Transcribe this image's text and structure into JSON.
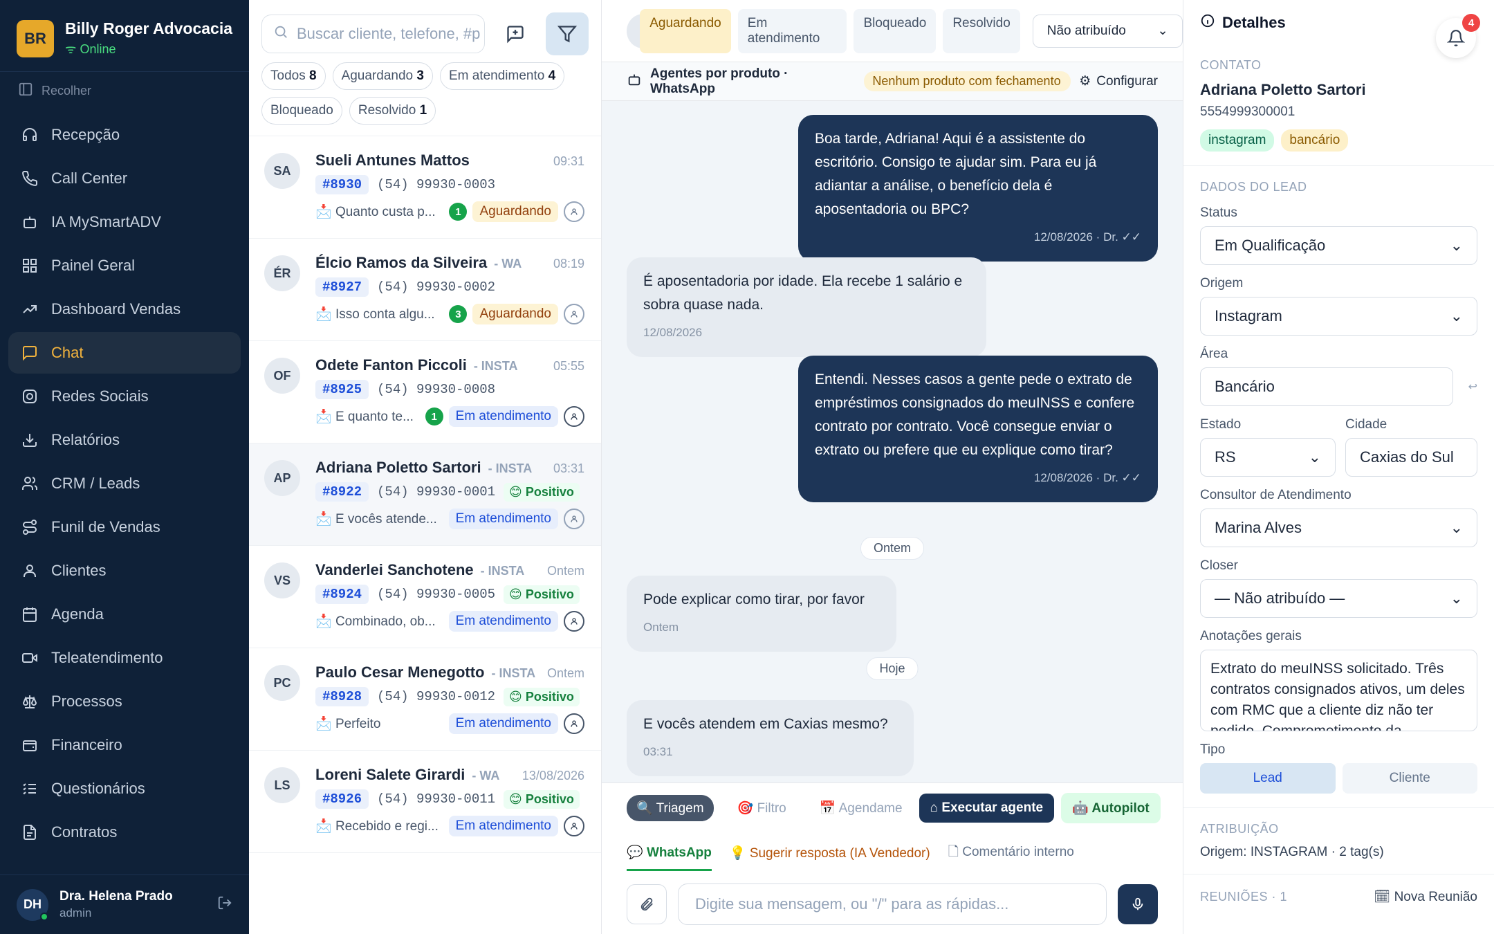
{
  "sidebar": {
    "brand_initials": "BR",
    "brand_name": "Billy Roger Advocacia",
    "status": "Online",
    "collapse_label": "Recolher",
    "items": [
      {
        "label": "Recepção",
        "icon": "headset-icon"
      },
      {
        "label": "Call Center",
        "icon": "phone-icon"
      },
      {
        "label": "IA MySmartADV",
        "icon": "bot-icon"
      },
      {
        "label": "Painel Geral",
        "icon": "grid-icon"
      },
      {
        "label": "Dashboard Vendas",
        "icon": "trend-icon"
      },
      {
        "label": "Chat",
        "icon": "chat-icon",
        "active": true
      },
      {
        "label": "Redes Sociais",
        "icon": "instagram-icon"
      },
      {
        "label": "Relatórios",
        "icon": "download-icon"
      },
      {
        "label": "CRM / Leads",
        "icon": "users-icon"
      },
      {
        "label": "Funil de Vendas",
        "icon": "funnel-icon"
      },
      {
        "label": "Clientes",
        "icon": "user-icon"
      },
      {
        "label": "Agenda",
        "icon": "calendar-icon"
      },
      {
        "label": "Teleatendimento",
        "icon": "video-icon"
      },
      {
        "label": "Processos",
        "icon": "scale-icon"
      },
      {
        "label": "Financeiro",
        "icon": "wallet-icon"
      },
      {
        "label": "Questionários",
        "icon": "list-icon"
      },
      {
        "label": "Contratos",
        "icon": "file-icon"
      }
    ],
    "user": {
      "initials": "DH",
      "name": "Dra. Helena Prado",
      "role": "admin"
    }
  },
  "list": {
    "search_placeholder": "Buscar cliente, telefone, #p",
    "chips": [
      {
        "label": "Todos",
        "count": "8"
      },
      {
        "label": "Aguardando",
        "count": "3"
      },
      {
        "label": "Em atendimento",
        "count": "4"
      },
      {
        "label": "Bloqueado",
        "count": ""
      },
      {
        "label": "Resolvido",
        "count": "1"
      }
    ],
    "conversations": [
      {
        "initials": "SA",
        "name": "Sueli Antunes Mattos",
        "source": "",
        "time": "09:31",
        "ticket": "#8930",
        "phone": "(54) 99930-0003",
        "sentiment": "",
        "preview": "Quanto custa p...",
        "unread": "1",
        "status": "Aguardando",
        "status_kind": "wait"
      },
      {
        "initials": "ÉR",
        "name": "Élcio Ramos da Silveira",
        "source": "- WA",
        "time": "08:19",
        "ticket": "#8927",
        "phone": "(54) 99930-0002",
        "sentiment": "",
        "preview": "Isso conta algu...",
        "unread": "3",
        "status": "Aguardando",
        "status_kind": "wait"
      },
      {
        "initials": "OF",
        "name": "Odete Fanton Piccoli",
        "source": "- INSTA",
        "time": "05:55",
        "ticket": "#8925",
        "phone": "(54) 99930-0008",
        "sentiment": "",
        "preview": "E quanto te...",
        "unread": "1",
        "status": "Em atendimento",
        "status_kind": "att"
      },
      {
        "initials": "AP",
        "name": "Adriana Poletto Sartori",
        "source": "- INSTA",
        "time": "03:31",
        "ticket": "#8922",
        "phone": "(54) 99930-0001",
        "sentiment": "😊 Positivo",
        "preview": "E vocês atende...",
        "unread": "",
        "status": "Em atendimento",
        "status_kind": "att",
        "selected": true
      },
      {
        "initials": "VS",
        "name": "Vanderlei Sanchotene",
        "source": "- INSTA",
        "time": "Ontem",
        "ticket": "#8924",
        "phone": "(54) 99930-0005",
        "sentiment": "😊 Positivo",
        "preview": "Combinado, ob...",
        "unread": "",
        "status": "Em atendimento",
        "status_kind": "att"
      },
      {
        "initials": "PC",
        "name": "Paulo Cesar Menegotto",
        "source": "- INSTA",
        "time": "Ontem",
        "ticket": "#8928",
        "phone": "(54) 99930-0012",
        "sentiment": "😊 Positivo",
        "preview": "Perfeito",
        "unread": "",
        "status": "Em atendimento",
        "status_kind": "att"
      },
      {
        "initials": "LS",
        "name": "Loreni Salete Girardi",
        "source": "- WA",
        "time": "13/08/2026",
        "ticket": "#8926",
        "phone": "(54) 99930-0011",
        "sentiment": "😊 Positivo",
        "preview": "Recebido e regi...",
        "unread": "",
        "status": "Em atendimento",
        "status_kind": "att"
      }
    ]
  },
  "chat": {
    "status_tabs": [
      "Aguardando",
      "Em atendimento",
      "Bloqueado",
      "Resolvido"
    ],
    "assign_value": "Não atribuído",
    "agents_title": "Agentes por produto · WhatsApp",
    "agents_warning": "Nenhum produto com fechamento",
    "configure_label": "Configurar",
    "messages": [
      {
        "dir": "out",
        "text": "Boa tarde, Adriana! Aqui é a assistente do escritório. Consigo te ajudar sim. Para eu já adiantar a análise, o benefício dela é aposentadoria ou BPC?",
        "meta": "12/08/2026 · Dr. ✓✓"
      },
      {
        "dir": "in",
        "text": "É aposentadoria por idade. Ela recebe 1 salário e sobra quase nada.",
        "meta": "12/08/2026"
      },
      {
        "dir": "out",
        "text": "Entendi. Nesses casos a gente pede o extrato de empréstimos consignados do meuINSS e confere contrato por contrato. Você consegue enviar o extrato ou prefere que eu explique como tirar?",
        "meta": "12/08/2026 · Dr. ✓✓"
      },
      {
        "dir": "day",
        "text": "Ontem"
      },
      {
        "dir": "in",
        "text": "Pode explicar como tirar, por favor",
        "meta": "Ontem"
      },
      {
        "dir": "day",
        "text": "Hoje"
      },
      {
        "dir": "in",
        "text": "E vocês atendem em Caxias mesmo?",
        "meta": "03:31"
      }
    ],
    "flow_steps": [
      "🔍 Triagem",
      "🎯 Filtro",
      "📅 Agendame"
    ],
    "run_agent": "Executar agente",
    "autopilot": "🤖 Autopilot",
    "composer_tabs": [
      "WhatsApp",
      "Sugerir resposta (IA Vendedor)",
      "Comentário interno"
    ],
    "composer_placeholder": "Digite sua mensagem, ou \"/\" para as rápidas..."
  },
  "details": {
    "title": "Detalhes",
    "notifications": "4",
    "contact_title": "CONTATO",
    "contact_name": "Adriana Poletto Sartori",
    "contact_phone": "5554999300001",
    "tags": [
      "instagram",
      "bancário"
    ],
    "lead_title": "DADOS DO LEAD",
    "status_label": "Status",
    "status_value": "Em Qualificação",
    "origin_label": "Origem",
    "origin_value": "Instagram",
    "area_label": "Área",
    "area_value": "Bancário",
    "state_label": "Estado",
    "state_value": "RS",
    "city_label": "Cidade",
    "city_value": "Caxias do Sul",
    "consultant_label": "Consultor de Atendimento",
    "consultant_value": "Marina Alves",
    "closer_label": "Closer",
    "closer_value": "— Não atribuído —",
    "notes_label": "Anotações gerais",
    "notes_value": "Extrato do meuINSS solicitado. Três contratos consignados ativos, um deles com RMC que a cliente diz não ter pedido. Comprometimento da",
    "type_label": "Tipo",
    "type_lead": "Lead",
    "type_client": "Cliente",
    "attribution_title": "ATRIBUIÇÃO",
    "attribution_value": "Origem: INSTAGRAM · 2 tag(s)",
    "meetings_title": "REUNIÕES · 1",
    "new_meeting": "Nova Reunião"
  }
}
